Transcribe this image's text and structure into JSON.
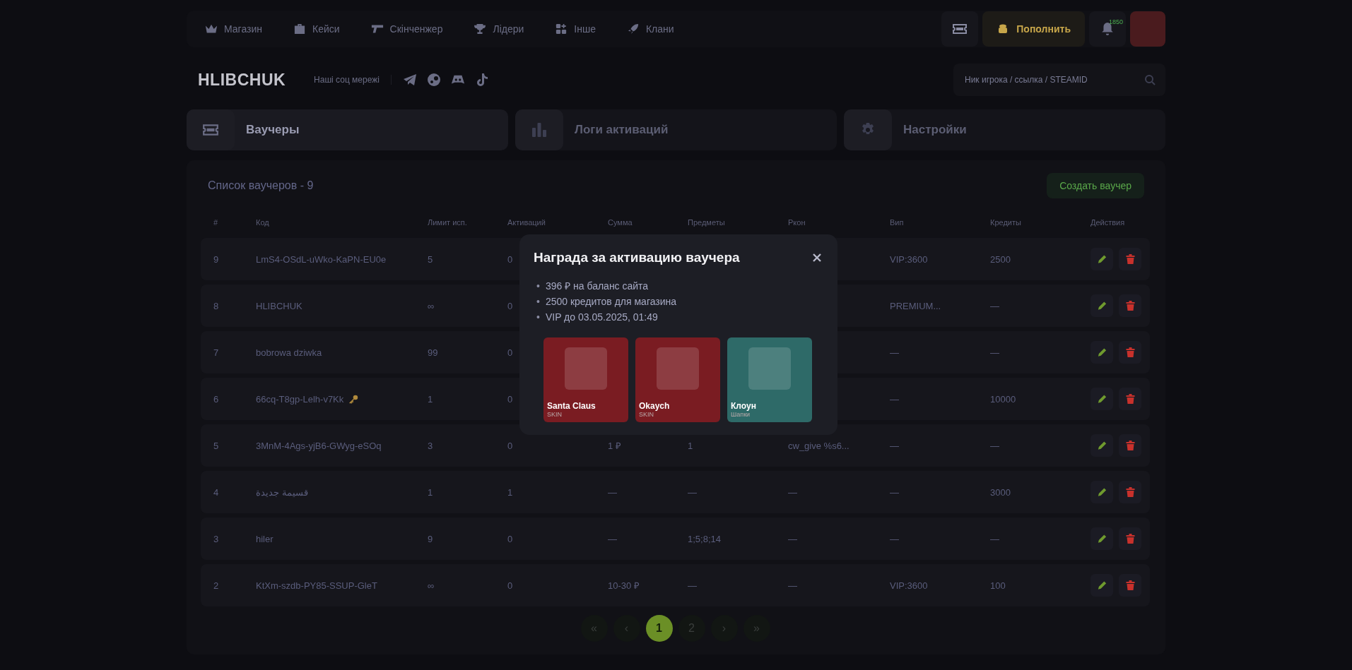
{
  "nav": {
    "items": [
      {
        "label": "Магазин"
      },
      {
        "label": "Кейси"
      },
      {
        "label": "Скінченжер"
      },
      {
        "label": "Лідери"
      },
      {
        "label": "Інше"
      },
      {
        "label": "Клани"
      }
    ],
    "topup": "Пополнить",
    "badge": "1850"
  },
  "header": {
    "logo": "HLIBCHUK",
    "socials_label": "Наші соц мережі",
    "search": {
      "placeholder": "Ник игрока / ссылка / STEAMID"
    }
  },
  "tabs": [
    {
      "label": "Ваучеры",
      "selected": true
    },
    {
      "label": "Логи активаций",
      "selected": false
    },
    {
      "label": "Настройки",
      "selected": false
    }
  ],
  "panel": {
    "title": "Список ваучеров - 9",
    "create_button": "Создать ваучер",
    "table": {
      "columns": [
        "#",
        "Код",
        "Лимит исп.",
        "Активаций",
        "Сумма",
        "Предметы",
        "Ркон",
        "Вип",
        "Кредиты",
        "Действия"
      ],
      "rows": [
        {
          "num": "9",
          "code": "LmS4-OSdL-uWko-KaPN-EU0e",
          "has_key": false,
          "limit": "5",
          "activations": "0",
          "vip": "VIP:3600",
          "credits": "2500"
        },
        {
          "num": "8",
          "code": "HLIBCHUK",
          "has_key": false,
          "limit": "∞",
          "activations": "0",
          "vip": "PREMIUM...",
          "credits": "—"
        },
        {
          "num": "7",
          "code": "bobrowa dziwka",
          "has_key": false,
          "limit": "99",
          "activations": "0",
          "vip": "—",
          "credits": "—"
        },
        {
          "num": "6",
          "code": "66cq-T8gp-Lelh-v7Kk",
          "has_key": true,
          "limit": "1",
          "activations": "0",
          "vip": "—",
          "credits": "10000"
        },
        {
          "num": "5",
          "code": "3MnM-4Ags-yjB6-GWyg-eSOq",
          "has_key": false,
          "limit": "3",
          "activations": "0",
          "sum": "1 ₽",
          "items": "1",
          "rcon": "cw_give %s6...",
          "vip": "—",
          "credits": "—"
        },
        {
          "num": "4",
          "code": "قسيمة جديدة",
          "has_key": false,
          "limit": "1",
          "activations": "1",
          "sum": "—",
          "items": "—",
          "rcon": "—",
          "vip": "—",
          "credits": "3000"
        },
        {
          "num": "3",
          "code": "hiler",
          "has_key": false,
          "limit": "9",
          "activations": "0",
          "sum": "—",
          "items": "1;5;8;14",
          "rcon": "—",
          "vip": "—",
          "credits": "—"
        },
        {
          "num": "2",
          "code": "KtXm-szdb-PY85-SSUP-GleT",
          "has_key": false,
          "limit": "∞",
          "activations": "0",
          "sum": "10-30 ₽",
          "items": "—",
          "rcon": "—",
          "vip": "VIP:3600",
          "credits": "100"
        }
      ]
    }
  },
  "pagination": [
    {
      "label": "«",
      "selected": false
    },
    {
      "label": "‹",
      "selected": false
    },
    {
      "label": "1",
      "selected": true
    },
    {
      "label": "2",
      "selected": false
    },
    {
      "label": "›",
      "selected": false
    },
    {
      "label": "»",
      "selected": false
    }
  ],
  "modal": {
    "title": "Награда за активацию ваучера",
    "rewards": [
      {
        "bullet": "•",
        "text": "396 ₽ на баланс сайта"
      },
      {
        "bullet": "•",
        "text": "2500 кредитов для магазина"
      },
      {
        "bullet": "•",
        "text": "VIP до 03.05.2025, 01:49"
      }
    ],
    "items": [
      {
        "name": "Santa Claus",
        "type": "SKIN",
        "color": "#7a1c22"
      },
      {
        "name": "Okaych",
        "type": "SKIN",
        "color": "#7a1c22"
      },
      {
        "name": "Клоун",
        "type": "Шапки",
        "color": "#2e6a68"
      }
    ]
  }
}
